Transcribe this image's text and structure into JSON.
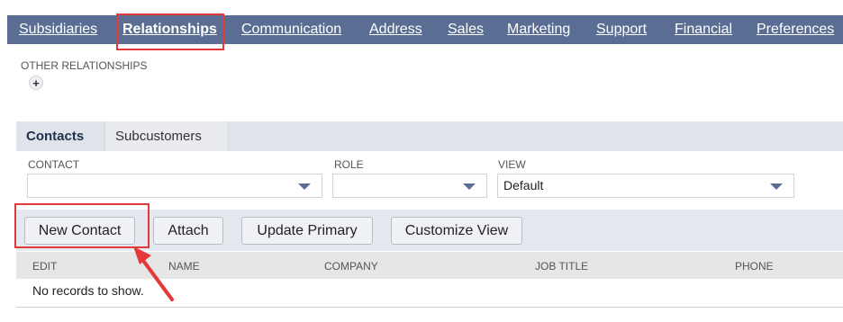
{
  "tabs": [
    {
      "label": "Subsidiaries",
      "active": false
    },
    {
      "label": "Relationships",
      "active": true
    },
    {
      "label": "Communication",
      "active": false
    },
    {
      "label": "Address",
      "active": false
    },
    {
      "label": "Sales",
      "active": false
    },
    {
      "label": "Marketing",
      "active": false
    },
    {
      "label": "Support",
      "active": false
    },
    {
      "label": "Financial",
      "active": false
    },
    {
      "label": "Preferences",
      "active": false
    }
  ],
  "other_relationships": {
    "label": "OTHER RELATIONSHIPS",
    "add_icon": "plus-icon"
  },
  "subtabs": {
    "contacts": "Contacts",
    "subcustomers": "Subcustomers"
  },
  "filters": {
    "contact": {
      "label": "CONTACT",
      "value": ""
    },
    "role": {
      "label": "ROLE",
      "value": ""
    },
    "view": {
      "label": "VIEW",
      "value": "Default"
    }
  },
  "buttons": {
    "new_contact": "New Contact",
    "attach": "Attach",
    "update_primary": "Update Primary",
    "customize_view": "Customize View"
  },
  "list": {
    "columns": [
      "EDIT",
      "NAME",
      "COMPANY",
      "JOB TITLE",
      "PHONE"
    ],
    "empty_message": "No records to show."
  },
  "colors": {
    "tab_bar": "#5a6e93",
    "annotation": "#e23a3a"
  }
}
